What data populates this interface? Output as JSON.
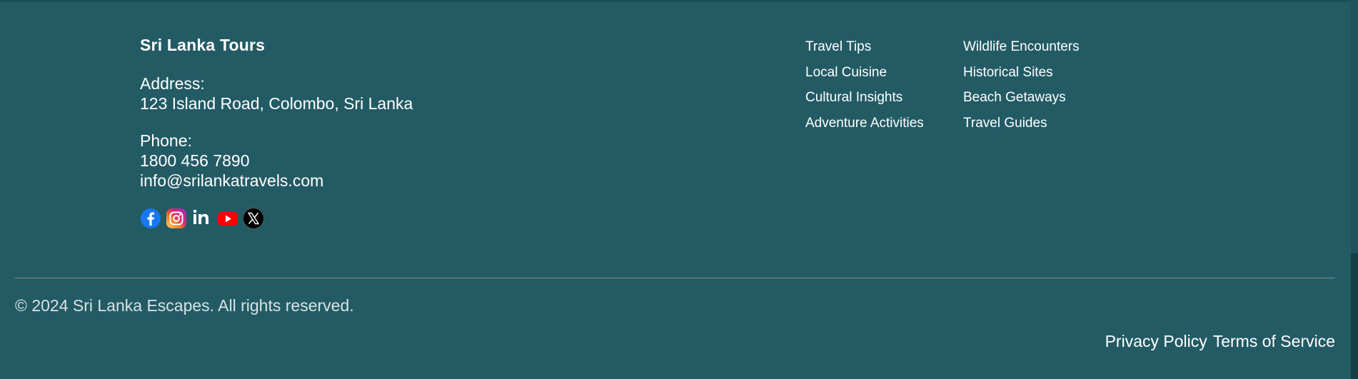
{
  "footer": {
    "brand": "Sri Lanka Tours",
    "address_label": "Address:",
    "address_value": "123 Island Road, Colombo, Sri Lanka",
    "phone_label": "Phone:",
    "phone_value": "1800 456 7890",
    "email": "info@srilankatravels.com",
    "socials": [
      {
        "name": "facebook-icon",
        "color": "#1877f2"
      },
      {
        "name": "instagram-icon",
        "color": "#e1306c"
      },
      {
        "name": "linkedin-icon",
        "color": "#0a66c2"
      },
      {
        "name": "youtube-icon",
        "color": "#ff0000"
      },
      {
        "name": "x-icon",
        "color": "#000000"
      }
    ],
    "links_col1": [
      "Travel Tips",
      "Local Cuisine",
      "Cultural Insights",
      "Adventure Activities"
    ],
    "links_col2": [
      "Wildlife Encounters",
      "Historical Sites",
      "Beach Getaways",
      "Travel Guides"
    ],
    "copyright": "© 2024 Sri Lanka Escapes. All rights reserved.",
    "privacy": "Privacy Policy",
    "terms": "Terms of Service"
  },
  "colors": {
    "background": "#235b65",
    "divider": "#8a8a76",
    "text": "#ffffff"
  }
}
